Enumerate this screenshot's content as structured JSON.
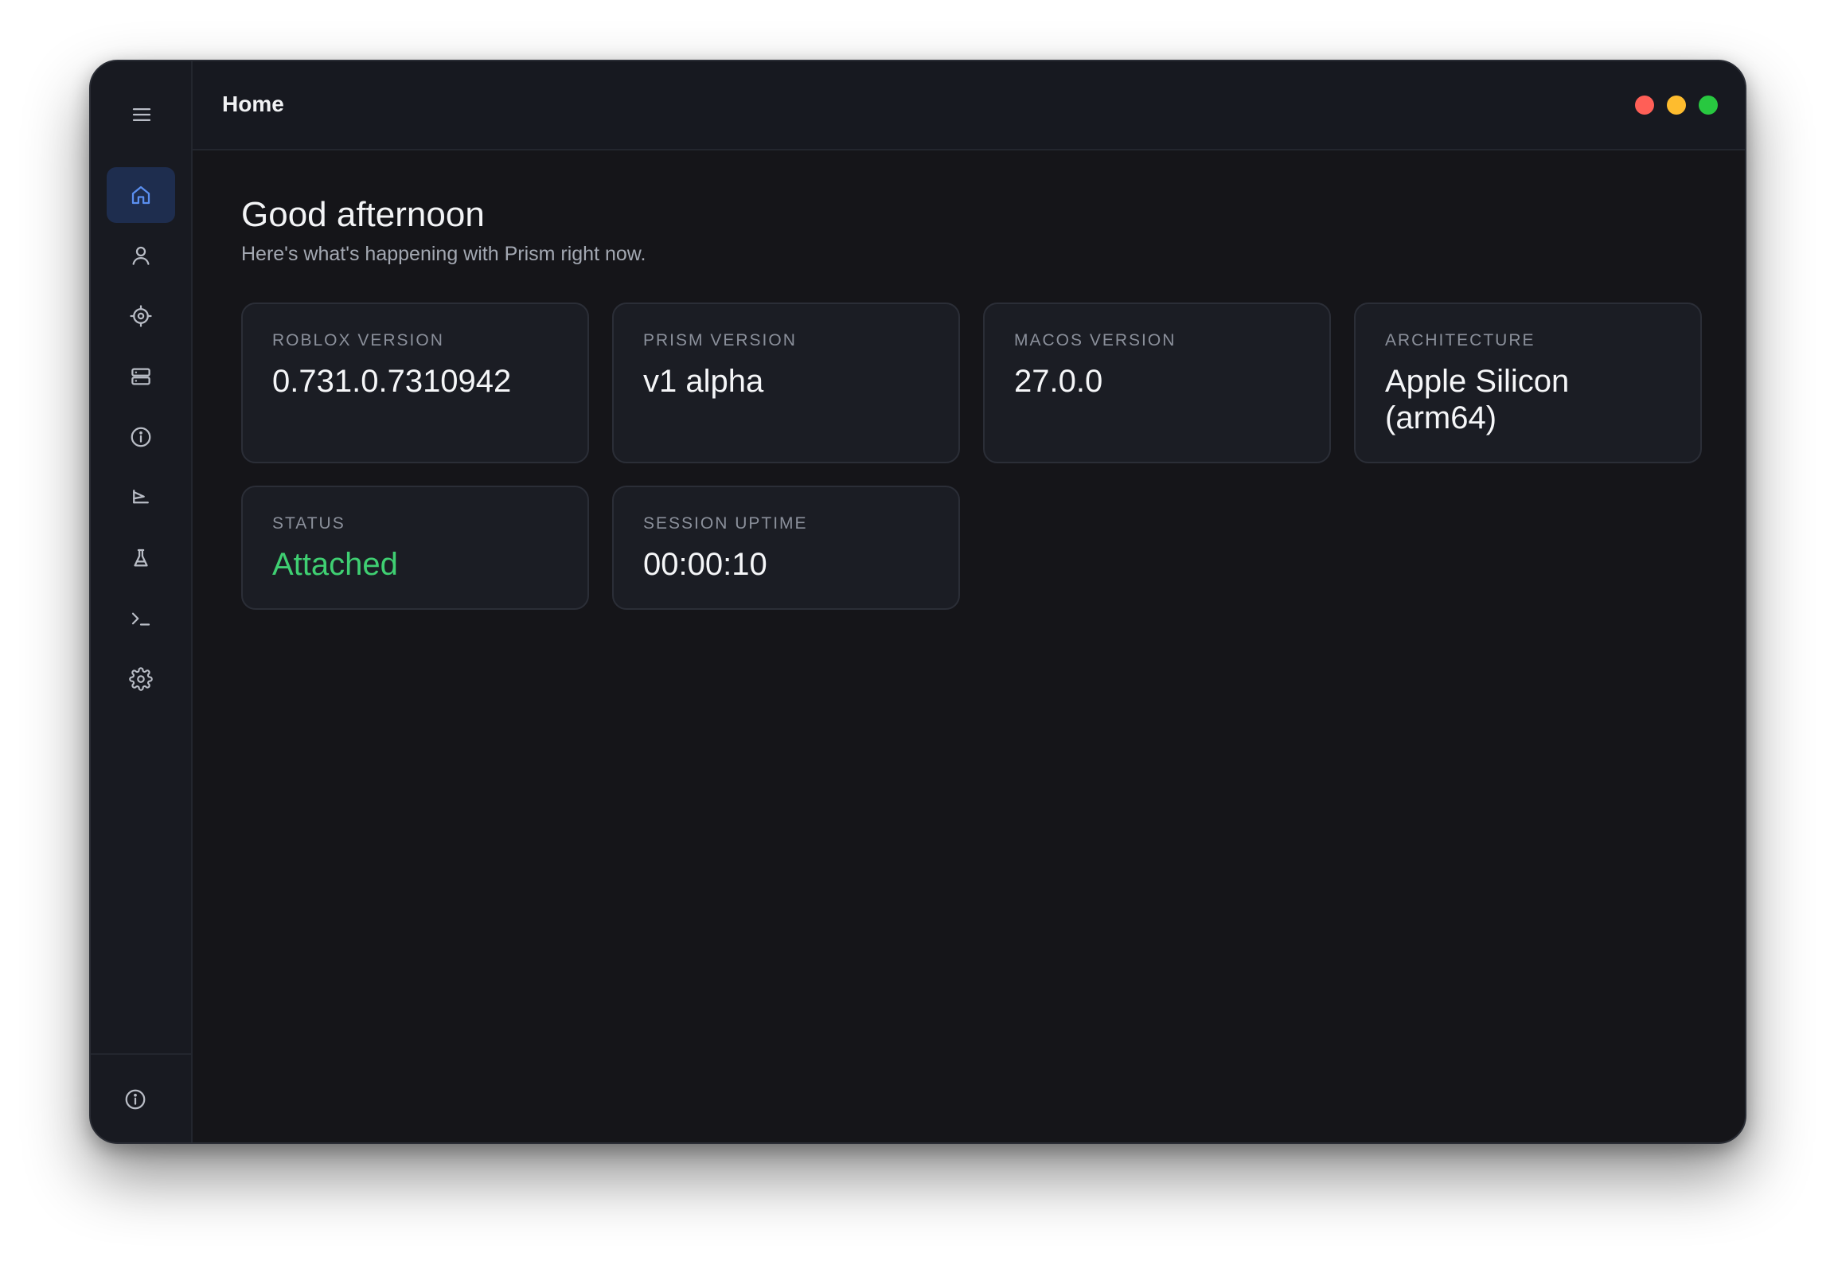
{
  "header": {
    "title": "Home"
  },
  "window_controls": {
    "close_color": "#ff5f57",
    "minimize_color": "#febc2e",
    "zoom_color": "#28c840"
  },
  "sidebar": {
    "menu_icon": "hamburger-menu-icon",
    "items": [
      {
        "icon": "home-icon",
        "active": true
      },
      {
        "icon": "user-icon",
        "active": false
      },
      {
        "icon": "crosshair-icon",
        "active": false
      },
      {
        "icon": "server-icon",
        "active": false
      },
      {
        "icon": "info-icon",
        "active": false
      },
      {
        "icon": "flag-icon",
        "active": false
      },
      {
        "icon": "flask-icon",
        "active": false
      },
      {
        "icon": "terminal-icon",
        "active": false
      },
      {
        "icon": "gear-icon",
        "active": false
      }
    ],
    "footer_icon": "info-icon",
    "active_color": "#5b8ff0"
  },
  "main": {
    "greeting": "Good afternoon",
    "subtitle": "Here's what's happening with Prism right now.",
    "cards": [
      {
        "label": "ROBLOX VERSION",
        "value": "0.731.0.7310942"
      },
      {
        "label": "PRISM VERSION",
        "value": "v1 alpha"
      },
      {
        "label": "MACOS VERSION",
        "value": "27.0.0"
      },
      {
        "label": "ARCHITECTURE",
        "value": "Apple Silicon (arm64)"
      },
      {
        "label": "STATUS",
        "value": "Attached",
        "color": "#3fcf72"
      },
      {
        "label": "SESSION UPTIME",
        "value": "00:00:10"
      }
    ]
  }
}
